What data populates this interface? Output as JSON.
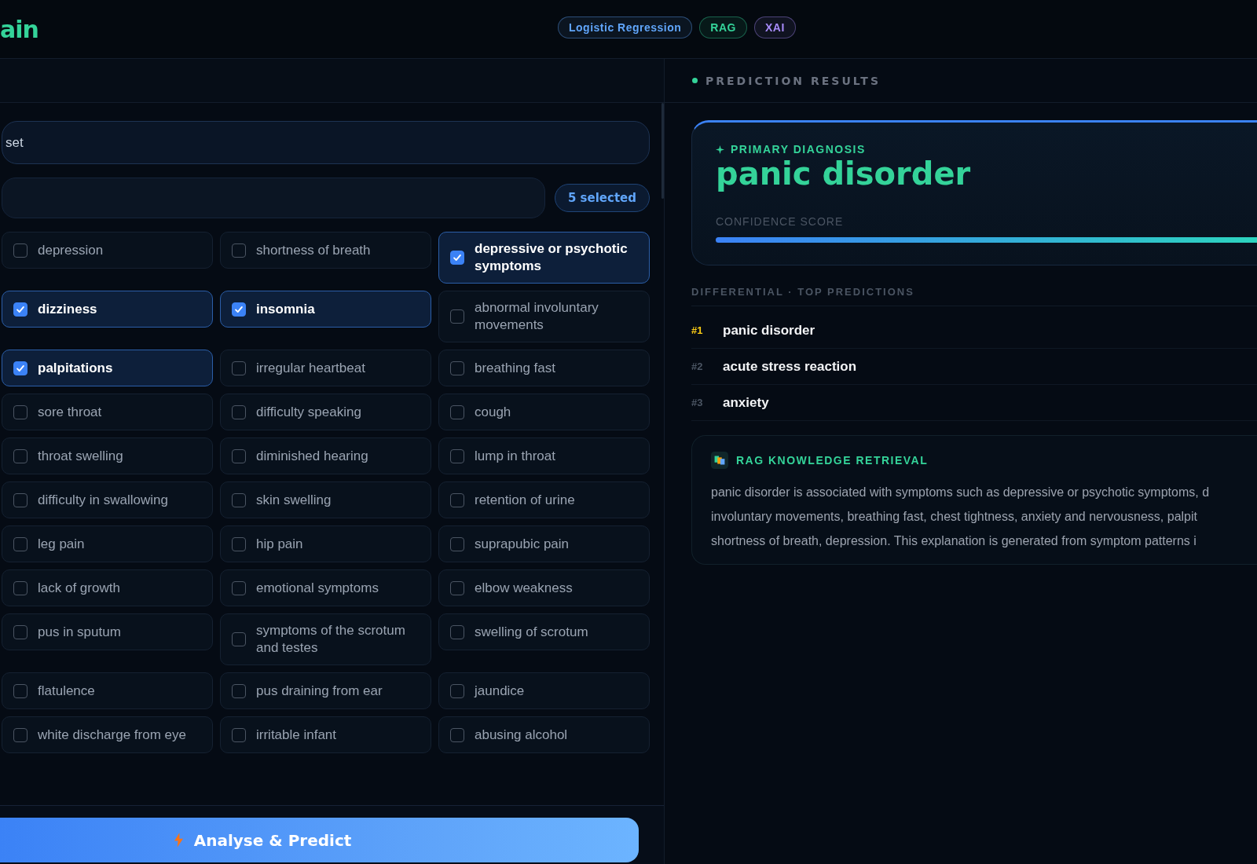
{
  "header": {
    "logo": "ain",
    "badges": [
      {
        "label": "Logistic Regression",
        "color": "#60a5fa"
      },
      {
        "label": "RAG",
        "color": "#34d399"
      },
      {
        "label": "XAI",
        "color": "#a78bfa"
      }
    ]
  },
  "input_panel": {
    "dataset_field": {
      "value": "set"
    },
    "selected_count": "5 selected",
    "symptoms": [
      {
        "label": "depression",
        "checked": false
      },
      {
        "label": "shortness of breath",
        "checked": false
      },
      {
        "label": "depressive or psychotic symptoms",
        "checked": true
      },
      {
        "label": "dizziness",
        "checked": true
      },
      {
        "label": "insomnia",
        "checked": true
      },
      {
        "label": "abnormal involuntary movements",
        "checked": false
      },
      {
        "label": "palpitations",
        "checked": true
      },
      {
        "label": "irregular heartbeat",
        "checked": false
      },
      {
        "label": "breathing fast",
        "checked": false
      },
      {
        "label": "sore throat",
        "checked": false
      },
      {
        "label": "difficulty speaking",
        "checked": false
      },
      {
        "label": "cough",
        "checked": false
      },
      {
        "label": "throat swelling",
        "checked": false
      },
      {
        "label": "diminished hearing",
        "checked": false
      },
      {
        "label": "lump in throat",
        "checked": false
      },
      {
        "label": "difficulty in swallowing",
        "checked": false
      },
      {
        "label": "skin swelling",
        "checked": false
      },
      {
        "label": "retention of urine",
        "checked": false
      },
      {
        "label": "leg pain",
        "checked": false
      },
      {
        "label": "hip pain",
        "checked": false
      },
      {
        "label": "suprapubic pain",
        "checked": false
      },
      {
        "label": "lack of growth",
        "checked": false
      },
      {
        "label": "emotional symptoms",
        "checked": false
      },
      {
        "label": "elbow weakness",
        "checked": false
      },
      {
        "label": "pus in sputum",
        "checked": false
      },
      {
        "label": "symptoms of the scrotum and testes",
        "checked": false
      },
      {
        "label": "swelling of scrotum",
        "checked": false
      },
      {
        "label": "flatulence",
        "checked": false
      },
      {
        "label": "pus draining from ear",
        "checked": false
      },
      {
        "label": "jaundice",
        "checked": false
      },
      {
        "label": "white discharge from eye",
        "checked": false
      },
      {
        "label": "irritable infant",
        "checked": false
      },
      {
        "label": "abusing alcohol",
        "checked": false
      }
    ],
    "predict_button": "Analyse & Predict"
  },
  "results": {
    "title": "PREDICTION RESULTS",
    "primary": {
      "label": "PRIMARY DIAGNOSIS",
      "diagnosis": "panic disorder",
      "confidence_label": "CONFIDENCE SCORE",
      "level": 1.0
    },
    "differential_title": "DIFFERENTIAL · TOP PREDICTIONS",
    "predictions": [
      {
        "rank": "#1",
        "name": "panic disorder",
        "color": "#facc15"
      },
      {
        "rank": "#2",
        "name": "acute stress reaction",
        "color": "#4b5563"
      },
      {
        "rank": "#3",
        "name": "anxiety",
        "color": "#4b5563"
      }
    ],
    "rag": {
      "title": "RAG KNOWLEDGE RETRIEVAL",
      "lines": [
        "panic disorder is associated with symptoms such as depressive or psychotic symptoms, d",
        "involuntary movements, breathing fast, chest tightness, anxiety and nervousness, palpit",
        "shortness of breath, depression. This explanation is generated from symptom patterns i"
      ]
    }
  }
}
